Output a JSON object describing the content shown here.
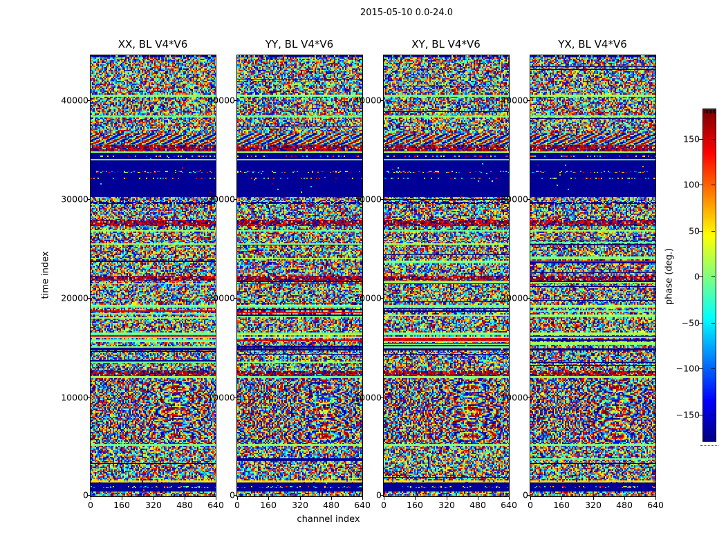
{
  "suptitle": "2015-05-10 0.0-24.0",
  "chart_data": {
    "type": "heatmap",
    "title": "2015-05-10 0.0-24.0",
    "xlabel": "channel index",
    "ylabel": "time index",
    "xlim": [
      0,
      640
    ],
    "ylim": [
      0,
      44500
    ],
    "x_ticks": [
      0,
      160,
      320,
      480,
      640
    ],
    "x_tick_labels": [
      "0",
      "160",
      "320",
      "480",
      "640"
    ],
    "y_ticks": [
      0,
      10000,
      20000,
      30000,
      40000
    ],
    "y_tick_labels": [
      "0",
      "10000",
      "20000",
      "30000",
      "40000"
    ],
    "panels": [
      {
        "title": "XX, BL V4*V6",
        "seed": 101
      },
      {
        "title": "YY, BL V4*V6",
        "seed": 202
      },
      {
        "title": "XY, BL V4*V6",
        "seed": 303
      },
      {
        "title": "YX, BL V4*V6",
        "seed": 404
      }
    ],
    "colorbar": {
      "label": "phase (deg.)",
      "ticks": [
        150,
        100,
        50,
        0,
        -50,
        -100,
        -150
      ],
      "tick_labels": [
        "150",
        "100",
        "50",
        "0",
        "−50",
        "−100",
        "−150"
      ],
      "vmin": -180,
      "vmax": 180,
      "colormap": "jet"
    },
    "colors": {
      "flagged_navy": "#000080",
      "uniform_green": "#80ff80",
      "band_yellow": "#ffe600",
      "band_dark_red": "#8b0000",
      "background": "#ffffff"
    },
    "row_bands": [
      {
        "from": 44250,
        "to": 44500,
        "kind": "specks"
      },
      {
        "from": 40500,
        "to": 44250,
        "kind": "noise"
      },
      {
        "from": 40300,
        "to": 40500,
        "kind": "green"
      },
      {
        "from": 38400,
        "to": 40300,
        "kind": "noise"
      },
      {
        "from": 38200,
        "to": 38400,
        "kind": "green"
      },
      {
        "from": 36600,
        "to": 38200,
        "kind": "noise"
      },
      {
        "from": 35400,
        "to": 36600,
        "kind": "wave"
      },
      {
        "from": 34800,
        "to": 35400,
        "kind": "red"
      },
      {
        "from": 34600,
        "to": 34800,
        "kind": "green"
      },
      {
        "from": 34350,
        "to": 34600,
        "kind": "navy"
      },
      {
        "from": 34200,
        "to": 34350,
        "kind": "specks"
      },
      {
        "from": 34000,
        "to": 34200,
        "kind": "navy"
      },
      {
        "from": 33850,
        "to": 34000,
        "kind": "green"
      },
      {
        "from": 32800,
        "to": 33850,
        "kind": "navy"
      },
      {
        "from": 32600,
        "to": 32800,
        "kind": "specks"
      },
      {
        "from": 32150,
        "to": 32600,
        "kind": "navy"
      },
      {
        "from": 32000,
        "to": 32150,
        "kind": "specks"
      },
      {
        "from": 30200,
        "to": 32000,
        "kind": "navy"
      },
      {
        "from": 29700,
        "to": 30200,
        "kind": "noise"
      },
      {
        "from": 29500,
        "to": 29700,
        "kind": "specks"
      },
      {
        "from": 27850,
        "to": 29500,
        "kind": "noise"
      },
      {
        "from": 27250,
        "to": 27850,
        "kind": "red"
      },
      {
        "from": 26850,
        "to": 27250,
        "kind": "noise"
      },
      {
        "from": 26700,
        "to": 26850,
        "kind": "green"
      },
      {
        "from": 25600,
        "to": 26700,
        "kind": "noise"
      },
      {
        "from": 25300,
        "to": 25600,
        "kind": "stripes"
      },
      {
        "from": 24200,
        "to": 25300,
        "kind": "noise"
      },
      {
        "from": 23500,
        "to": 24200,
        "kind": "stripes"
      },
      {
        "from": 22250,
        "to": 23500,
        "kind": "noise"
      },
      {
        "from": 21700,
        "to": 22250,
        "kind": "red"
      },
      {
        "from": 21400,
        "to": 21700,
        "kind": "stripes"
      },
      {
        "from": 19300,
        "to": 21400,
        "kind": "noise"
      },
      {
        "from": 19000,
        "to": 19300,
        "kind": "green"
      },
      {
        "from": 17900,
        "to": 19000,
        "kind": "stripes"
      },
      {
        "from": 16500,
        "to": 17900,
        "kind": "noise"
      },
      {
        "from": 16200,
        "to": 16500,
        "kind": "green"
      },
      {
        "from": 14900,
        "to": 16200,
        "kind": "stripes"
      },
      {
        "from": 14700,
        "to": 14900,
        "kind": "navy"
      },
      {
        "from": 13700,
        "to": 14700,
        "kind": "noise"
      },
      {
        "from": 13400,
        "to": 13700,
        "kind": "stripes"
      },
      {
        "from": 12600,
        "to": 13400,
        "kind": "noise"
      },
      {
        "from": 12100,
        "to": 12600,
        "kind": "red"
      },
      {
        "from": 11900,
        "to": 12100,
        "kind": "green"
      },
      {
        "from": 5300,
        "to": 11900,
        "kind": "moire"
      },
      {
        "from": 5050,
        "to": 5300,
        "kind": "green"
      },
      {
        "from": 3800,
        "to": 5050,
        "kind": "noise"
      },
      {
        "from": 3500,
        "to": 3800,
        "kind": "stripes"
      },
      {
        "from": 1600,
        "to": 3500,
        "kind": "noise"
      },
      {
        "from": 1350,
        "to": 1600,
        "kind": "yellow"
      },
      {
        "from": 1000,
        "to": 1350,
        "kind": "navy"
      },
      {
        "from": 770,
        "to": 1000,
        "kind": "specks"
      },
      {
        "from": 420,
        "to": 770,
        "kind": "navy"
      },
      {
        "from": 0,
        "to": 420,
        "kind": "noise"
      }
    ]
  }
}
